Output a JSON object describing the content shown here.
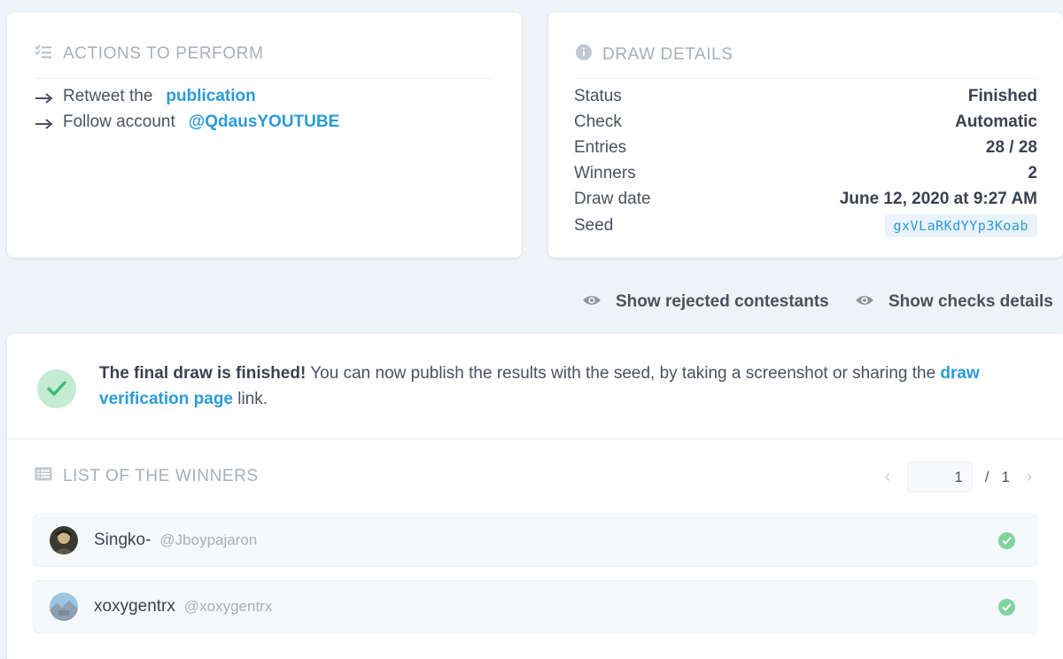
{
  "actions": {
    "title": "ACTIONS TO PERFORM",
    "items": [
      {
        "text": "Retweet the",
        "link": "publication"
      },
      {
        "text": "Follow account",
        "link": "@QdausYOUTUBE"
      }
    ]
  },
  "details": {
    "title": "DRAW DETAILS",
    "rows": [
      {
        "label": "Status",
        "value": "Finished"
      },
      {
        "label": "Check",
        "value": "Automatic"
      },
      {
        "label": "Entries",
        "value": "28 / 28"
      },
      {
        "label": "Winners",
        "value": "2"
      },
      {
        "label": "Draw date",
        "value": "June 12, 2020 at 9:27 AM"
      },
      {
        "label": "Seed",
        "value": "gxVLaRKdYYp3Koab"
      }
    ]
  },
  "toolbar": {
    "show_rejected": "Show rejected contestants",
    "show_checks": "Show checks details"
  },
  "notice": {
    "bold": "The final draw is finished!",
    "text": " You can now publish the results with the seed, by taking a screenshot or sharing the ",
    "link": "draw verification page",
    "suffix": " link."
  },
  "winners": {
    "title": "LIST OF THE WINNERS",
    "page_current": "1",
    "page_sep": "/",
    "page_total": "1",
    "items": [
      {
        "name": "Singko-",
        "handle": "@Jboypajaron"
      },
      {
        "name": "xoxygentrx",
        "handle": "@xoxygentrx"
      }
    ]
  },
  "colors": {
    "accent": "#2b9bd8",
    "success": "#7fd3a0",
    "background": "#eef3f8"
  }
}
